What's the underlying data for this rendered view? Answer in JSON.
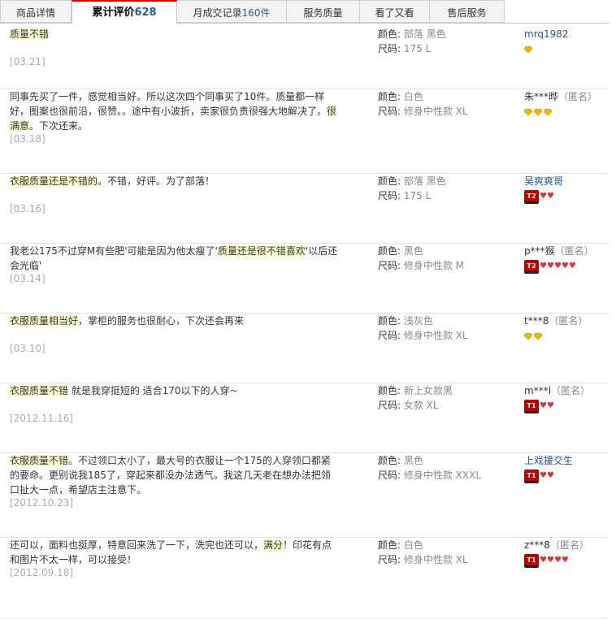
{
  "tabs": [
    {
      "label": "商品详情",
      "count": ""
    },
    {
      "label": "累计评价",
      "count": "628"
    },
    {
      "label": "月成交记录",
      "count": "160件"
    },
    {
      "label": "服务质量",
      "count": ""
    },
    {
      "label": "看了又看",
      "count": ""
    },
    {
      "label": "售后服务",
      "count": ""
    }
  ],
  "labels": {
    "color": "颜色:",
    "size": "尺码:",
    "anon": "（匿名）"
  },
  "reviews": [
    {
      "highlight": "质量不错",
      "text": "",
      "date": "[03.21]",
      "color": "部落 黑色",
      "size": "175 L",
      "user": "mrq1982",
      "anon": false,
      "badge": "",
      "hearts": 0,
      "gems": 1,
      "link": true
    },
    {
      "highlight": "",
      "text": "同事先买了一件，感觉相当好。所以这次四个同事买了10件。质量都一样好，图案也很前沿，很赞。。途中有小波折，卖家很负责很强大地解决了。",
      "tail_hl": "很满意",
      "tail": "。下次还来。",
      "date": "[03.18]",
      "color": "白色",
      "size": "修身中性款 XL",
      "user": "朱***晔",
      "anon": true,
      "badge": "",
      "hearts": 0,
      "gems": 3,
      "link": false
    },
    {
      "highlight": "衣服质量还是不错的",
      "text": "。不错，好评。为了部落！",
      "date": "[03.16]",
      "color": "部落 黑色",
      "size": "175 L",
      "user": "吴爽爽哥",
      "anon": false,
      "badge": "T2",
      "hearts": 2,
      "gems": 0,
      "link": true
    },
    {
      "highlight": "",
      "text": "我老公175不过穿M有些肥'可能是因为他太瘦了'",
      "mid_hl": "质量还是很不错喜欢",
      "tail": "'以后还会光临'",
      "date": "[03.14]",
      "color": "黑色",
      "size": "修身中性款 M",
      "user": "p***猴",
      "anon": true,
      "badge": "T2",
      "hearts": 5,
      "gems": 0,
      "link": false
    },
    {
      "highlight": "衣服质量相当好",
      "text": "，掌柜的服务也很耐心，下次还会再来",
      "date": "[03.10]",
      "color": "浅灰色",
      "size": "修身中性款 XL",
      "user": "t***8",
      "anon": true,
      "badge": "",
      "hearts": 0,
      "gems": 2,
      "link": false
    },
    {
      "highlight": "衣服质量不错",
      "text": " 就是我穿挺短的 适合170以下的人穿~",
      "date": "[2012.11.16]",
      "color": "新上女款黑",
      "size": "女款 XL",
      "user": "m***l",
      "anon": true,
      "badge": "T1",
      "hearts": 2,
      "gems": 0,
      "link": false
    },
    {
      "highlight": "衣服质量不错",
      "text": "。不过领口太小了，最大号的衣服让一个175的人穿领口都紧的要命。更别说我185了，穿起来都没办法透气。我这几天老在想办法把领口扯大一点，希望店主注意下。",
      "date": "[2012.10.23]",
      "color": "黑色",
      "size": "修身中性款 XXXL",
      "user": "上戏援交生",
      "anon": false,
      "badge": "T1",
      "hearts": 2,
      "gems": 0,
      "link": true
    },
    {
      "highlight": "",
      "text": "还可以，面料也挺厚，特意回来洗了一下，洗完也还可以，",
      "mid_hl": "满分",
      "tail": "！印花有点和图片不太一样，可以接受！",
      "date": "[2012.09.18]",
      "color": "白色",
      "size": "修身中性款 XL",
      "user": "z***8",
      "anon": true,
      "badge": "T1",
      "hearts": 4,
      "gems": 0,
      "link": false
    }
  ]
}
